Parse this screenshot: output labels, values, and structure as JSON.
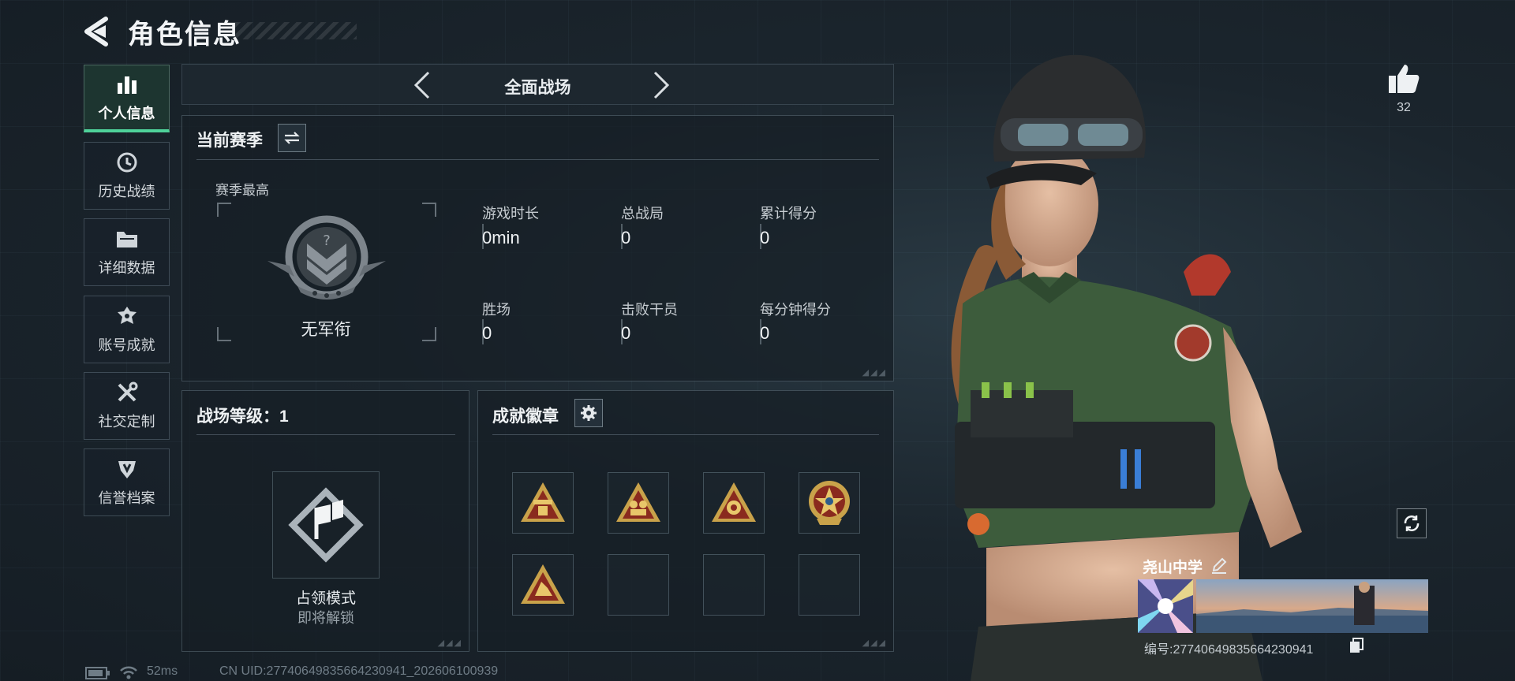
{
  "header": {
    "title": "角色信息"
  },
  "sidebar": {
    "items": [
      {
        "label": "个人信息",
        "icon": "bar-chart-icon"
      },
      {
        "label": "历史战绩",
        "icon": "history-clock-icon"
      },
      {
        "label": "详细数据",
        "icon": "folder-icon"
      },
      {
        "label": "账号成就",
        "icon": "achievement-icon"
      },
      {
        "label": "社交定制",
        "icon": "tools-icon"
      },
      {
        "label": "信誉档案",
        "icon": "shield-icon"
      }
    ],
    "active_index": 0
  },
  "mode_bar": {
    "name": "全面战场"
  },
  "season": {
    "title": "当前赛季",
    "best_label": "赛季最高",
    "rank_text": "无军衔",
    "stats": [
      {
        "label": "游戏时长",
        "value": "0min"
      },
      {
        "label": "总战局",
        "value": "0"
      },
      {
        "label": "累计得分",
        "value": "0"
      },
      {
        "label": "胜场",
        "value": "0"
      },
      {
        "label": "击败干员",
        "value": "0"
      },
      {
        "label": "每分钟得分",
        "value": "0"
      }
    ]
  },
  "battlefield_level": {
    "title": "战场等级：1",
    "mode_name": "占领模式",
    "mode_status": "即将解锁"
  },
  "badges": {
    "title": "成就徽章",
    "slots": [
      "triangle-badge",
      "triangle-badge",
      "triangle-badge",
      "round-emblem-badge",
      "triangle-badge",
      "",
      "",
      ""
    ]
  },
  "profile": {
    "like_count": "32",
    "team_name": "尧山中学",
    "id_text": "编号:27740649835664230941"
  },
  "status_bar": {
    "ping": "52ms",
    "uid": "CN UID:27740649835664230941_202606100939"
  },
  "colors": {
    "accent_green": "#4fd29a",
    "badge_gold": "#c9a24a",
    "badge_red": "#8a2a1e"
  }
}
